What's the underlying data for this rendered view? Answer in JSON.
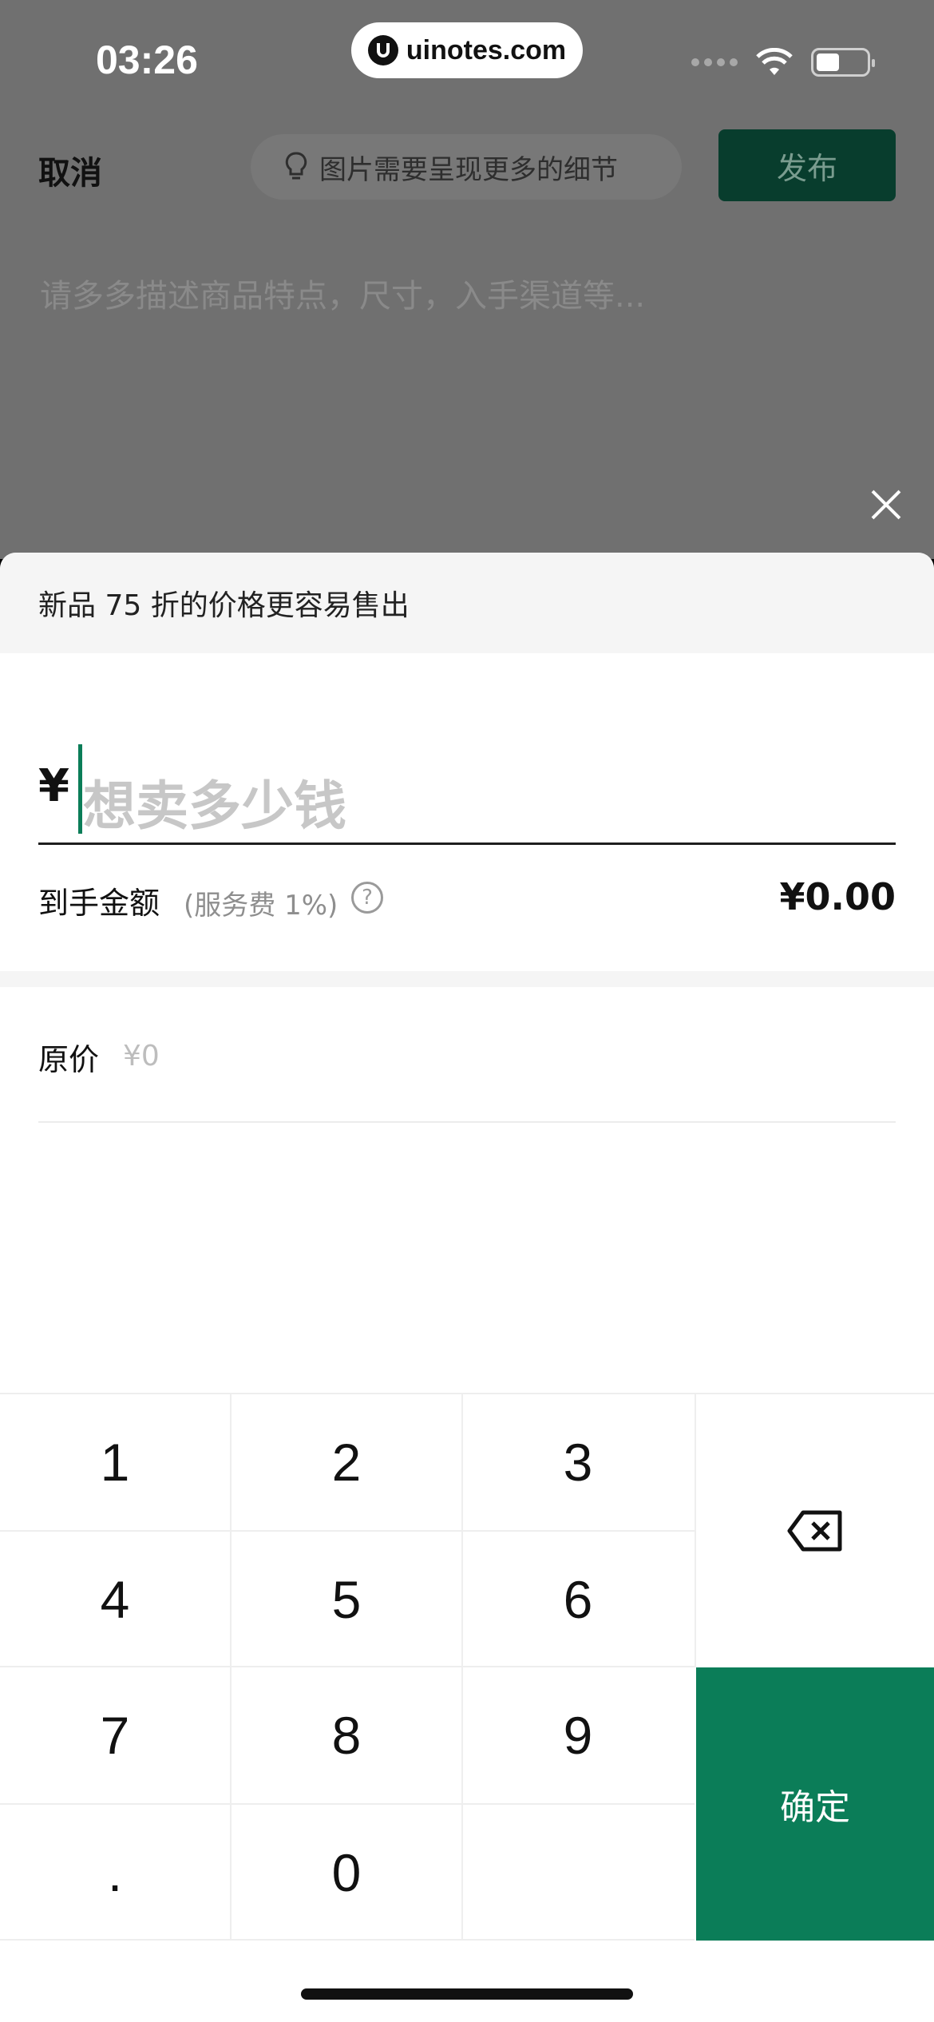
{
  "status_bar": {
    "time": "03:26",
    "url": "uinotes.com"
  },
  "header": {
    "cancel_label": "取消",
    "tip_text": "图片需要呈现更多的细节",
    "publish_label": "发布"
  },
  "description_placeholder": "请多多描述商品特点，尺寸，入手渠道等...",
  "sheet": {
    "promo_text": "新品 75 折的价格更容易售出",
    "currency_symbol": "¥",
    "price_placeholder": "想卖多少钱",
    "net_label": "到手金额",
    "fee_note": "(服务费 1%)",
    "help_symbol": "?",
    "net_amount": "¥0.00",
    "original_price_label": "原价",
    "original_price_value": "¥0"
  },
  "keypad": {
    "keys": [
      "1",
      "2",
      "3",
      "4",
      "5",
      "6",
      "7",
      "8",
      "9",
      ".",
      "0"
    ],
    "confirm_label": "确定"
  },
  "colors": {
    "accent": "#0b7d58",
    "publish_bg": "#083d2d"
  }
}
